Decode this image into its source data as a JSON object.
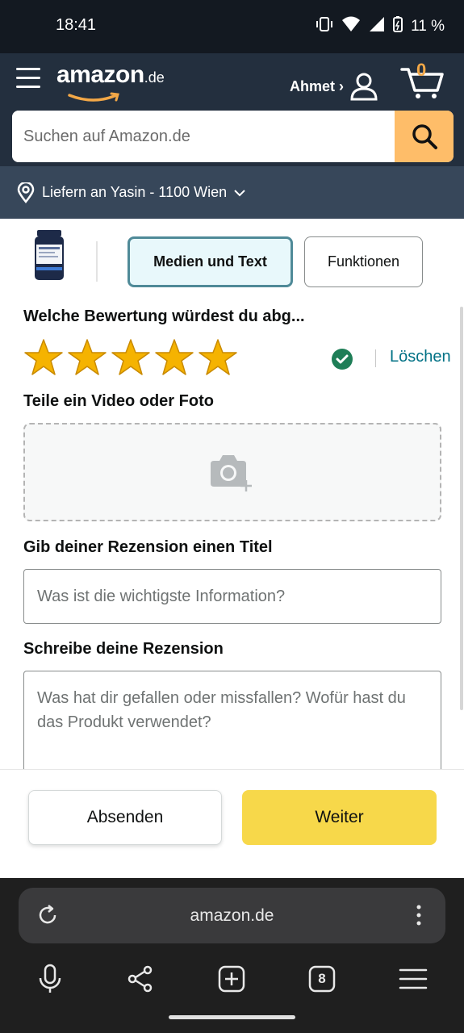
{
  "status": {
    "time": "18:41",
    "battery": "11 %"
  },
  "header": {
    "logo_main": "amazon",
    "logo_tld": ".de",
    "account_label": "Ahmet ›",
    "cart_count": "0",
    "search_placeholder": "Suchen auf Amazon.de"
  },
  "deliver": {
    "label": "Liefern an Yasin - 1100 Wien"
  },
  "tabs": {
    "active": "Medien und Text",
    "inactive": "Funktionen"
  },
  "rating": {
    "title": "Welche Bewertung würdest du abg...",
    "stars": 5,
    "delete_label": "Löschen"
  },
  "upload": {
    "title": "Teile ein Video oder Foto"
  },
  "review_title": {
    "label": "Gib deiner Rezension einen Titel",
    "placeholder": "Was ist die wichtigste Information?"
  },
  "review_body": {
    "label": "Schreibe deine Rezension",
    "placeholder": "Was hat dir gefallen oder missfallen? Wofür hast du das Produkt verwendet?"
  },
  "footer": {
    "submit_label": "Absenden",
    "next_label": "Weiter"
  },
  "browser": {
    "url": "amazon.de",
    "tab_count": "8"
  },
  "colors": {
    "brand_dark": "#232f3e",
    "accent": "#febd69",
    "star": "#f5b301",
    "link": "#007185",
    "primary_btn": "#f7d84a"
  }
}
